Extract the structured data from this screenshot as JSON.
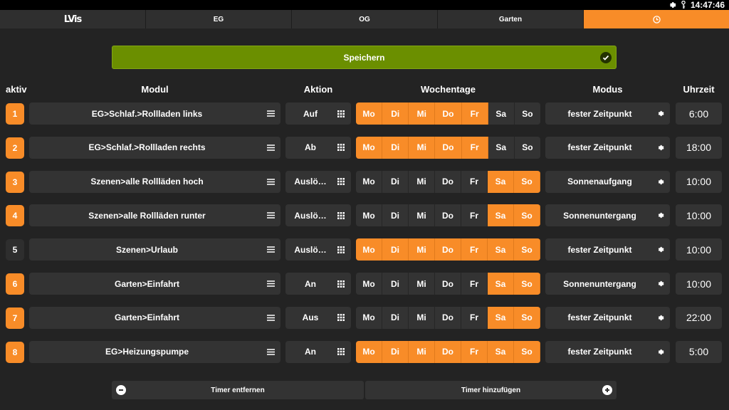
{
  "status": {
    "time": "14:47:46",
    "icons": [
      "gear-icon",
      "key-icon"
    ]
  },
  "tabs": [
    {
      "label": "LVis",
      "type": "logo"
    },
    {
      "label": "EG"
    },
    {
      "label": "OG"
    },
    {
      "label": "Garten"
    },
    {
      "label": "",
      "icon": "clock-icon",
      "active": true
    }
  ],
  "save": {
    "label": "Speichern"
  },
  "headers": {
    "aktiv": "aktiv",
    "modul": "Modul",
    "aktion": "Aktion",
    "wochentage": "Wochentage",
    "modus": "Modus",
    "uhrzeit": "Uhrzeit"
  },
  "weekdays": [
    "Mo",
    "Di",
    "Mi",
    "Do",
    "Fr",
    "Sa",
    "So"
  ],
  "timers": [
    {
      "num": "1",
      "active": true,
      "modul": "EG>Schlaf.>Rollladen links",
      "aktion": "Auf",
      "days": [
        1,
        1,
        1,
        1,
        1,
        0,
        0
      ],
      "modus": "fester Zeitpunkt",
      "time": "6:00"
    },
    {
      "num": "2",
      "active": true,
      "modul": "EG>Schlaf.>Rollladen rechts",
      "aktion": "Ab",
      "days": [
        1,
        1,
        1,
        1,
        1,
        0,
        0
      ],
      "modus": "fester Zeitpunkt",
      "time": "18:00"
    },
    {
      "num": "3",
      "active": true,
      "modul": "Szenen>alle Rollläden hoch",
      "aktion": "Auslö…",
      "days": [
        0,
        0,
        0,
        0,
        0,
        1,
        1
      ],
      "modus": "Sonnenaufgang",
      "time": "10:00"
    },
    {
      "num": "4",
      "active": true,
      "modul": "Szenen>alle Rollläden runter",
      "aktion": "Auslö…",
      "days": [
        0,
        0,
        0,
        0,
        0,
        1,
        1
      ],
      "modus": "Sonnenuntergang",
      "time": "10:00"
    },
    {
      "num": "5",
      "active": false,
      "modul": "Szenen>Urlaub",
      "aktion": "Auslö…",
      "days": [
        1,
        1,
        1,
        1,
        1,
        1,
        1
      ],
      "modus": "fester Zeitpunkt",
      "time": "10:00"
    },
    {
      "num": "6",
      "active": true,
      "modul": "Garten>Einfahrt",
      "aktion": "An",
      "days": [
        0,
        0,
        0,
        0,
        0,
        1,
        1
      ],
      "modus": "Sonnenuntergang",
      "time": "10:00"
    },
    {
      "num": "7",
      "active": true,
      "modul": "Garten>Einfahrt",
      "aktion": "Aus",
      "days": [
        0,
        0,
        0,
        0,
        0,
        1,
        1
      ],
      "modus": "fester Zeitpunkt",
      "time": "22:00"
    },
    {
      "num": "8",
      "active": true,
      "modul": "EG>Heizungspumpe",
      "aktion": "An",
      "days": [
        1,
        1,
        1,
        1,
        1,
        1,
        1
      ],
      "modus": "fester Zeitpunkt",
      "time": "5:00"
    }
  ],
  "footer": {
    "remove": "Timer entfernen",
    "add": "Timer hinzufügen"
  },
  "colors": {
    "accent": "#f88c28",
    "save": "#6b8f00",
    "bg": "#232323",
    "cell": "#333333"
  }
}
